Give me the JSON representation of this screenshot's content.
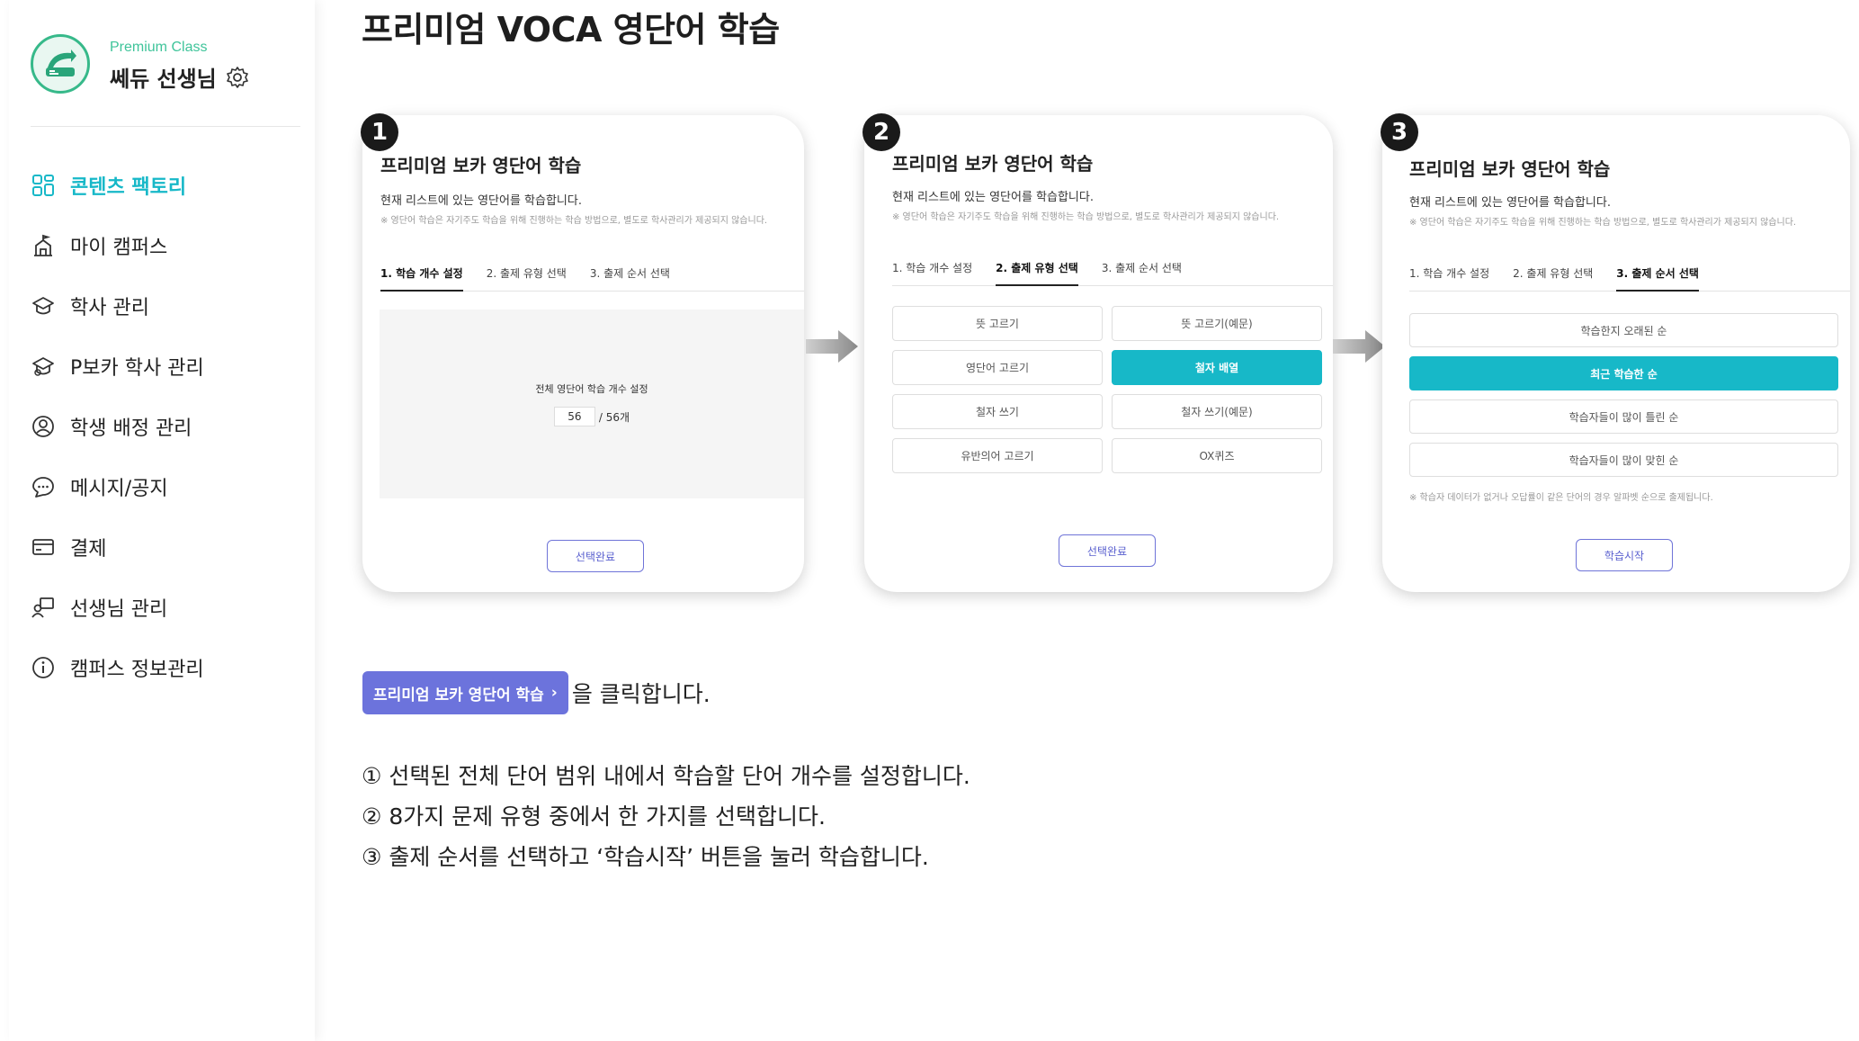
{
  "sidebar": {
    "premium_label": "Premium Class",
    "teacher_name": "쎄듀 선생님",
    "items": [
      {
        "label": "콘텐츠 팩토리",
        "icon": "grid-icon",
        "active": true
      },
      {
        "label": "마이 캠퍼스",
        "icon": "campus-icon",
        "active": false
      },
      {
        "label": "학사 관리",
        "icon": "graduation-cap-icon",
        "active": false
      },
      {
        "label": "P보카 학사 관리",
        "icon": "graduation-cap-icon",
        "active": false
      },
      {
        "label": "학생 배정 관리",
        "icon": "user-circle-icon",
        "active": false
      },
      {
        "label": "메시지/공지",
        "icon": "chat-bubble-icon",
        "active": false
      },
      {
        "label": "결제",
        "icon": "card-icon",
        "active": false
      },
      {
        "label": "선생님 관리",
        "icon": "teacher-icon",
        "active": false
      },
      {
        "label": "캠퍼스 정보관리",
        "icon": "info-icon",
        "active": false
      }
    ]
  },
  "main": {
    "title": "프리미엄 VOCA 영단어 학습"
  },
  "steps": [
    {
      "number": "1",
      "title": "프리미엄 보카 영단어 학습",
      "desc": "현재 리스트에 있는 영단어를 학습합니다.",
      "note": "※ 영단어 학습은 자기주도 학습을 위해 진행하는 학습 방법으로, 별도로 학사관리가 제공되지 않습니다.",
      "tabs": [
        "1. 학습 개수 설정",
        "2. 출제 유형 선택",
        "3. 출제 순서 선택"
      ],
      "active_tab": 0,
      "count_label": "전체 영단어 학습 개수 설정",
      "count_value": "56",
      "count_total": "/ 56개",
      "button": "선택완료"
    },
    {
      "number": "2",
      "title": "프리미엄 보카 영단어 학습",
      "desc": "현재 리스트에 있는 영단어를 학습합니다.",
      "note": "※ 영단어 학습은 자기주도 학습을 위해 진행하는 학습 방법으로, 별도로 학사관리가 제공되지 않습니다.",
      "tabs": [
        "1. 학습 개수 설정",
        "2. 출제 유형 선택",
        "3. 출제 순서 선택"
      ],
      "active_tab": 1,
      "options": [
        "뜻 고르기",
        "뜻 고르기(예문)",
        "영단어 고르기",
        "철자 배열",
        "철자 쓰기",
        "철자 쓰기(예문)",
        "유반의어 고르기",
        "OX퀴즈"
      ],
      "selected_option": 3,
      "button": "선택완료"
    },
    {
      "number": "3",
      "title": "프리미엄 보카 영단어 학습",
      "desc": "현재 리스트에 있는 영단어를 학습합니다.",
      "note": "※ 영단어 학습은 자기주도 학습을 위해 진행하는 학습 방법으로, 별도로 학사관리가 제공되지 않습니다.",
      "tabs": [
        "1. 학습 개수 설정",
        "2. 출제 유형 선택",
        "3. 출제 순서 선택"
      ],
      "active_tab": 2,
      "options": [
        "학습한지 오래된 순",
        "최근 학습한 순",
        "학습자들이 많이 틀린 순",
        "학습자들이 많이 맞힌 순"
      ],
      "selected_option": 1,
      "order_note": "※ 학습자 데이터가 없거나 오답률이 같은 단어의 경우 알파벳 순으로 출제됩니다.",
      "button": "학습시작"
    }
  ],
  "instructions": {
    "button_label": "프리미엄 보카 영단어 학습",
    "button_chevron": "›",
    "click_text": "을 클릭합니다.",
    "lines": [
      "① 선택된 전체 단어 범위 내에서 학습할 단어 개수를 설정합니다.",
      "② 8가지 문제 유형 중에서 한 가지를 선택합니다.",
      "③ 출제 순서를 선택하고 ‘학습시작’ 버튼을 눌러 학습합니다."
    ]
  },
  "colors": {
    "accent_teal": "#17b8c8",
    "accent_indigo": "#6c73dc",
    "brand_green": "#37b98a"
  }
}
